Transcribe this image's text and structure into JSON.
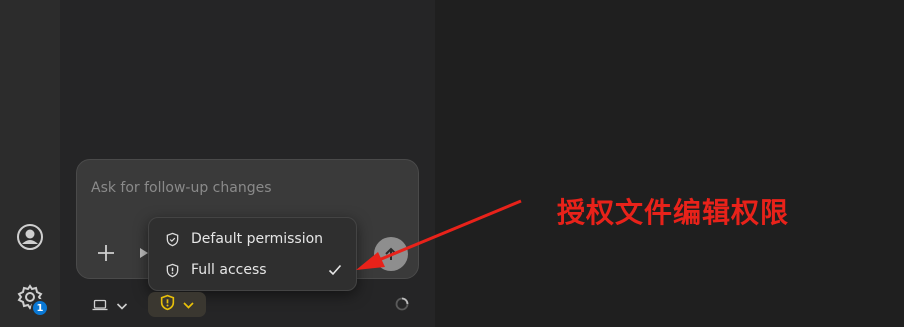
{
  "chat": {
    "placeholder": "Ask for follow-up changes"
  },
  "permissions_menu": {
    "items": [
      {
        "label": "Default permission",
        "icon": "shield-outline-icon",
        "selected": false
      },
      {
        "label": "Full access",
        "icon": "shield-alert-icon",
        "selected": true
      }
    ]
  },
  "activity_bar": {
    "account_icon": "account-icon",
    "settings_icon": "gear-icon",
    "settings_badge": "1"
  },
  "annotation": {
    "text": "授权文件编辑权限",
    "color": "#e8221a"
  },
  "colors": {
    "accent_warning": "#e8c00a",
    "badge": "#0a78d4"
  }
}
